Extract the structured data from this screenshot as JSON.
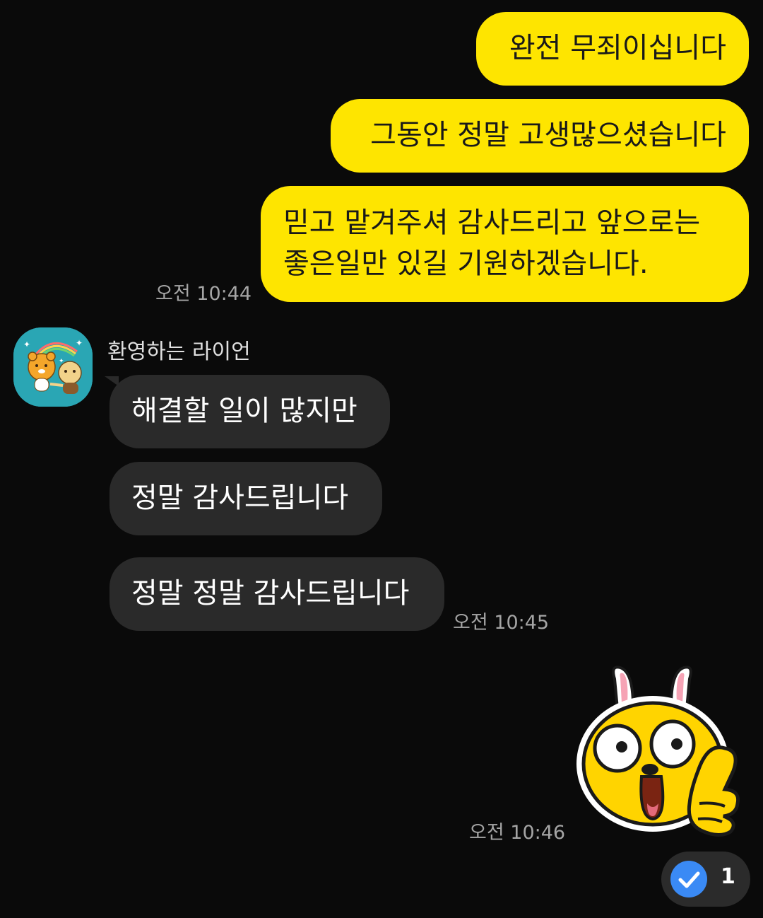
{
  "messages_out_1": {
    "line1": "완전 무죄이십니다",
    "line2": "그동안 정말 고생많으셨습니다",
    "line3a": "믿고 맡겨주셔 감사드리고 앞으로는",
    "line3b": "좋은일만 있길 기원하겠습니다.",
    "time": "오전 10:44"
  },
  "incoming": {
    "sender": "환영하는 라이언",
    "avatar_icon": "ryan-and-friend-rainbow-avatar-icon",
    "msg1": "해결할 일이 많지만",
    "msg2": "정말 감사드립니다",
    "msg3": "정말 정말 감사드립니다",
    "time": "오전 10:45"
  },
  "messages_out_2": {
    "emoticon_icon": "bunny-thumbs-up-emoticon-icon",
    "time": "오전 10:46"
  },
  "reaction": {
    "icon": "check-circle-icon",
    "count": "1"
  },
  "colors": {
    "background": "#0a0a0a",
    "my_bubble": "#fee500",
    "their_bubble": "#2a2a2a",
    "check_blue": "#3a8af5"
  }
}
